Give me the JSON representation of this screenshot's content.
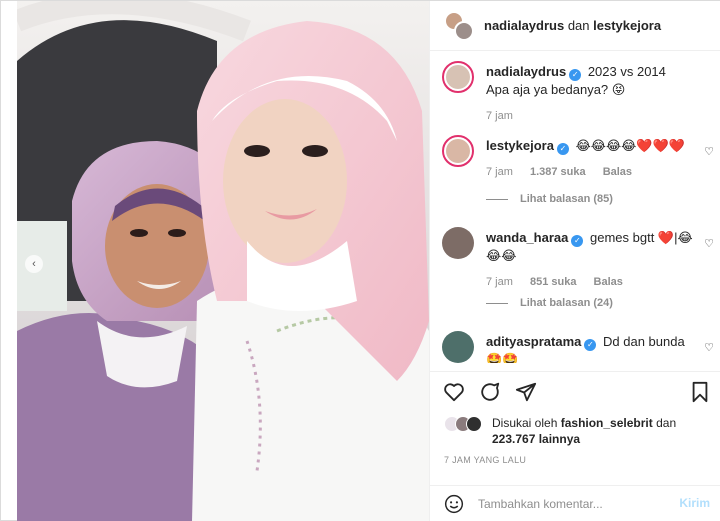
{
  "header": {
    "user1": "nadialaydrus",
    "connector": "dan",
    "user2": "lestykejora"
  },
  "caption": {
    "username": "nadialaydrus",
    "text": "2023 vs 2014",
    "text2": "Apa aja ya bedanya? 😝",
    "time": "7 jam"
  },
  "comments": [
    {
      "username": "lestykejora",
      "verified": true,
      "text": "😂😂😂😂❤️❤️❤️",
      "time": "7 jam",
      "likes": "1.387 suka",
      "reply": "Balas",
      "view_replies": "Lihat balasan (85)"
    },
    {
      "username": "wanda_haraa",
      "verified": true,
      "text": "gemes bgtt ❤️|😂",
      "text2": "😂😂",
      "time": "7 jam",
      "likes": "851 suka",
      "reply": "Balas",
      "view_replies": "Lihat balasan (24)"
    },
    {
      "username": "adityaspratama",
      "verified": true,
      "text": "Dd dan bunda",
      "text2": "🤩🤩"
    }
  ],
  "likes": {
    "prefix": "Disukai oleh",
    "user": "fashion_selebrit",
    "and": "dan",
    "count": "223.767 lainnya"
  },
  "timestamp": "7 JAM YANG LALU",
  "composer": {
    "placeholder": "Tambahkan komentar...",
    "post_label": "Kirim"
  },
  "colors": {
    "verified": "#3897f0",
    "story_ring": "#e1306c",
    "post_disabled": "#b2dffc"
  },
  "icons": [
    "heart-icon",
    "comment-icon",
    "share-icon",
    "bookmark-icon",
    "emoji-icon",
    "verified-icon",
    "chevron-left-icon"
  ]
}
